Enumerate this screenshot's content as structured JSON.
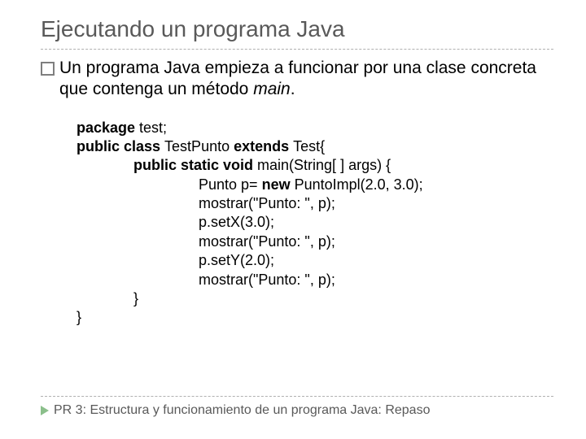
{
  "title": "Ejecutando un programa Java",
  "bullet": {
    "text_prefix": "Un programa Java empieza a funcionar por una clase concreta que contenga un método ",
    "text_italic": "main",
    "text_suffix": "."
  },
  "code": {
    "l1_a": "package",
    "l1_b": " test;",
    "l2_a": "public class ",
    "l2_b": "TestPunto ",
    "l2_c": "extends ",
    "l2_d": "Test{",
    "l3_a": "public static void ",
    "l3_b": "main(String[ ] args) {",
    "l4_a": "Punto p= ",
    "l4_b": "new ",
    "l4_c": "PuntoImpl(2.0, 3.0);",
    "l5": "mostrar(\"Punto: \", p);",
    "l6": "p.setX(3.0);",
    "l7": "mostrar(\"Punto: \", p);",
    "l8": "p.setY(2.0);",
    "l9": "mostrar(\"Punto: \", p);",
    "l10": "}",
    "l11": "}"
  },
  "footer": "PR 3: Estructura y funcionamiento de un programa Java: Repaso"
}
